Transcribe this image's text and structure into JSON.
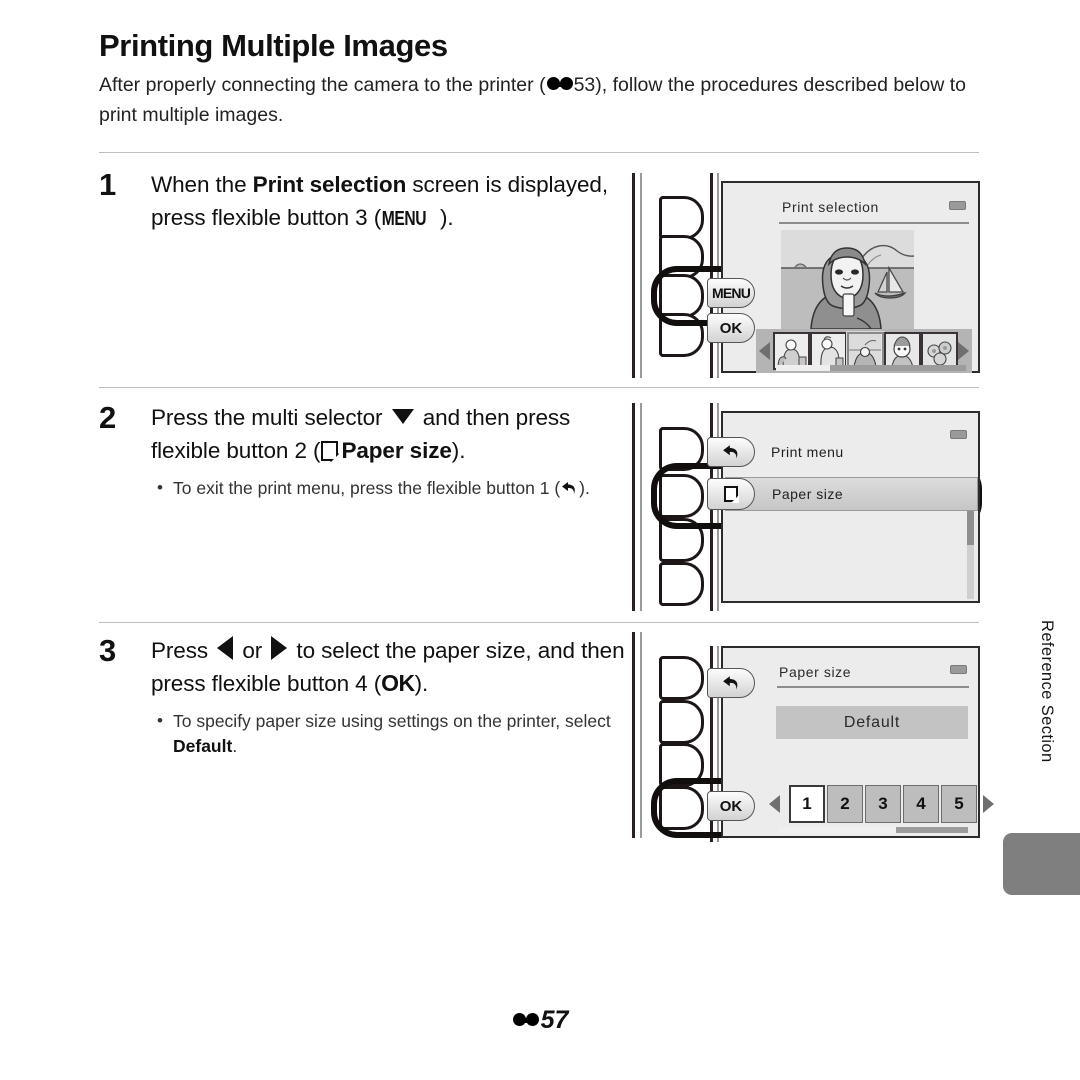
{
  "document": {
    "title": "Printing Multiple Images",
    "intro_before": "After properly connecting the camera to the printer (",
    "intro_ref": "53",
    "intro_after": "), follow the procedures described below to print multiple images.",
    "page_number": "57",
    "rail_label": "Reference Section"
  },
  "steps": [
    {
      "number": "1",
      "text_1": "When the ",
      "text_bold_1": "Print selection",
      "text_2": " screen is displayed, press flexible button 3 (",
      "icon": "MENU",
      "text_3": ").",
      "bullets": []
    },
    {
      "number": "2",
      "text_1": "Press the multi selector ",
      "text_2": " and then press flexible button 2 (",
      "text_bold_1": "Paper size",
      "text_3": ").",
      "bullets": [
        {
          "before": "To exit the print menu, press the flexible button 1 (",
          "after": ")."
        }
      ]
    },
    {
      "number": "3",
      "text_1": "Press ",
      "text_2": " or ",
      "text_3": " to select the paper size, and then press flexible button 4 (",
      "icon": "OK",
      "text_4": ").",
      "bullets": [
        {
          "before": "To specify paper size using settings on the printer, select ",
          "bold": "Default",
          "after": "."
        }
      ]
    }
  ],
  "illustrations": [
    {
      "id": "print-selection",
      "screen_title": "Print selection",
      "soft_keys": [
        "MENU",
        "OK"
      ],
      "highlighted_button": "3",
      "thumbnails": [
        "thumb-1",
        "thumb-2",
        "thumb-3",
        "thumb-4",
        "thumb-5"
      ],
      "selected_thumbnail_index": 2
    },
    {
      "id": "print-menu",
      "rows": [
        {
          "icon": "back-arrow",
          "label": "Print menu",
          "selected": false
        },
        {
          "icon": "paper",
          "label": "Paper size",
          "selected": true
        }
      ],
      "highlighted_button": "2"
    },
    {
      "id": "paper-size",
      "screen_title": "Paper size",
      "soft_keys": [
        "back-arrow",
        "OK"
      ],
      "default_label": "Default",
      "numbers": [
        "1",
        "2",
        "3",
        "4",
        "5"
      ],
      "selected_number_index": 0,
      "highlighted_button": "4"
    }
  ],
  "colors": {
    "rule": "#bdbdbd",
    "screen_bg": "#ececec",
    "selected_row": "#d2d2d2",
    "rail_tab": "#7f7f7f"
  }
}
